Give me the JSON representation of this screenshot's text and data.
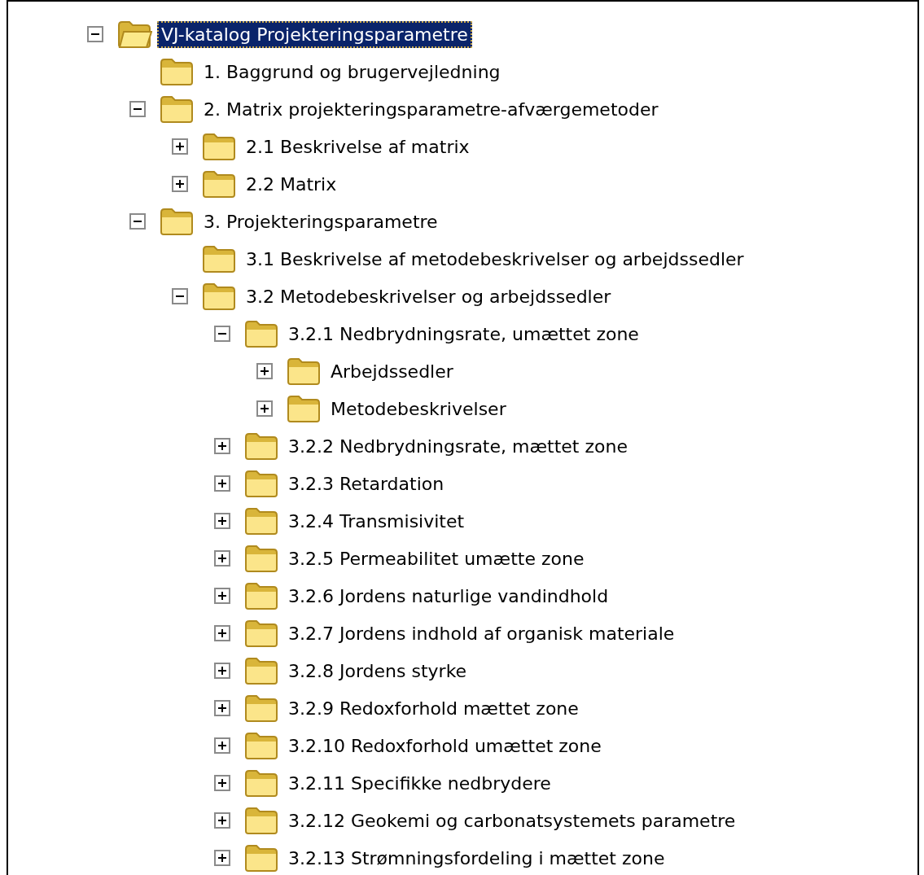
{
  "tree": [
    {
      "label": "VJ-katalog Projekteringsparametre",
      "selected": true,
      "expanded": true,
      "children": [
        {
          "label": "1. Baggrund og brugervejledning",
          "selected": false
        },
        {
          "label": "2. Matrix projekteringsparametre-afværgemetoder",
          "selected": false,
          "expanded": true,
          "children": [
            {
              "label": "2.1 Beskrivelse af matrix",
              "selected": false,
              "expanded": false
            },
            {
              "label": "2.2 Matrix",
              "selected": false,
              "expanded": false
            }
          ]
        },
        {
          "label": "3. Projekteringsparametre",
          "selected": false,
          "expanded": true,
          "children": [
            {
              "label": "3.1 Beskrivelse af metodebeskrivelser og arbejdssedler",
              "selected": false
            },
            {
              "label": "3.2 Metodebeskrivelser og arbejdssedler",
              "selected": false,
              "expanded": true,
              "children": [
                {
                  "label": "3.2.1 Nedbrydningsrate, umættet zone",
                  "selected": false,
                  "expanded": true,
                  "children": [
                    {
                      "label": "Arbejdssedler",
                      "selected": false,
                      "expanded": false
                    },
                    {
                      "label": "Metodebeskrivelser",
                      "selected": false,
                      "expanded": false
                    }
                  ]
                },
                {
                  "label": "3.2.2 Nedbrydningsrate, mættet zone",
                  "selected": false,
                  "expanded": false
                },
                {
                  "label": "3.2.3 Retardation",
                  "selected": false,
                  "expanded": false
                },
                {
                  "label": "3.2.4 Transmisivitet",
                  "selected": false,
                  "expanded": false
                },
                {
                  "label": "3.2.5 Permeabilitet umætte zone",
                  "selected": false,
                  "expanded": false
                },
                {
                  "label": "3.2.6 Jordens naturlige vandindhold",
                  "selected": false,
                  "expanded": false
                },
                {
                  "label": "3.2.7 Jordens indhold af organisk materiale",
                  "selected": false,
                  "expanded": false
                },
                {
                  "label": "3.2.8 Jordens styrke",
                  "selected": false,
                  "expanded": false
                },
                {
                  "label": "3.2.9 Redoxforhold mættet zone",
                  "selected": false,
                  "expanded": false
                },
                {
                  "label": "3.2.10 Redoxforhold umættet zone",
                  "selected": false,
                  "expanded": false
                },
                {
                  "label": "3.2.11 Specifikke nedbrydere",
                  "selected": false,
                  "expanded": false
                },
                {
                  "label": "3.2.12 Geokemi og carbonatsystemets parametre",
                  "selected": false,
                  "expanded": false
                },
                {
                  "label": "3.2.13 Strømningsfordeling i mættet zone",
                  "selected": false,
                  "expanded": false
                }
              ]
            }
          ]
        }
      ]
    }
  ]
}
